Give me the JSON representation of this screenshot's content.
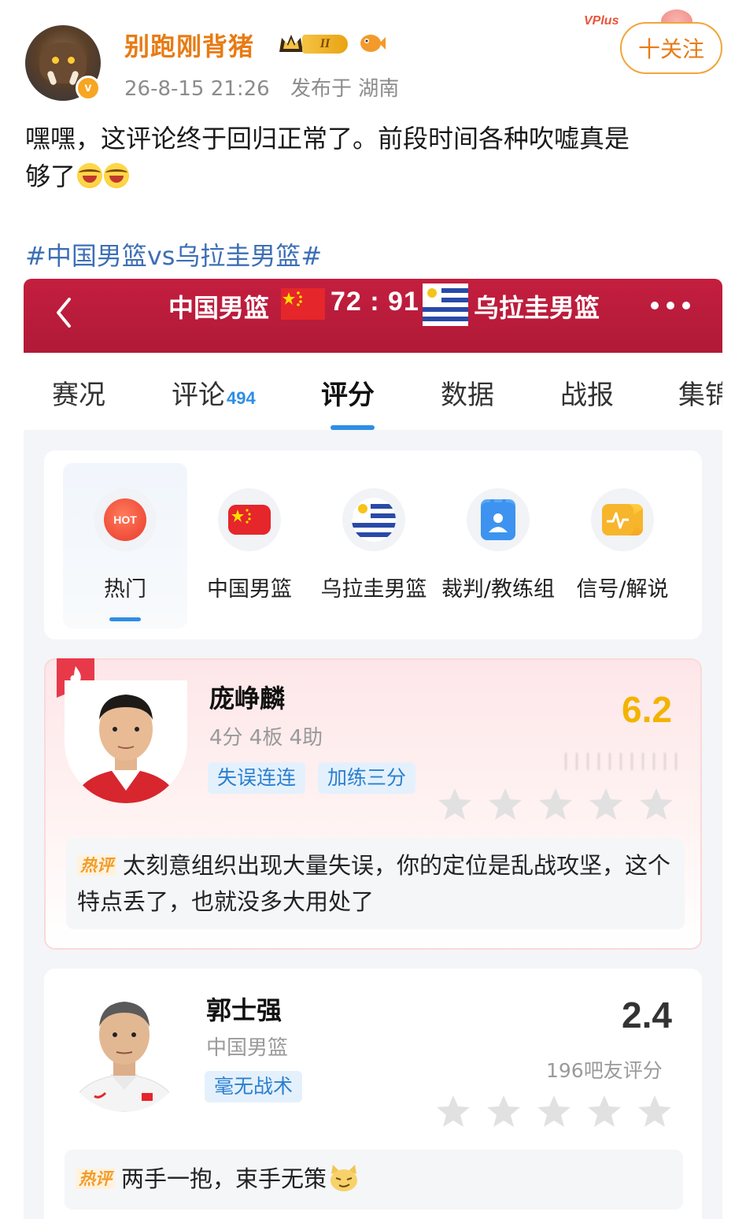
{
  "post": {
    "username": "别跑刚背猪",
    "vip_level": "II",
    "vplus_label": "VPlus",
    "timestamp": "26-8-15 21:26",
    "location": "发布于 湖南",
    "follow_label": "十关注",
    "text_line1": "嘿嘿，这评论终于回归正常了。前段时间各种吹嘘真是",
    "text_line2": "够了",
    "hashtag": "#中国男篮vs乌拉圭男篮#"
  },
  "game": {
    "home_team": "中国男篮",
    "score": "72 : 91",
    "away_team": "乌拉圭男篮",
    "colors": {
      "header": "#c41e3f",
      "accent": "#2d8ee6",
      "score_gold": "#f2b400"
    }
  },
  "tabs": [
    {
      "label": "赛况",
      "count": ""
    },
    {
      "label": "评论",
      "count": "494"
    },
    {
      "label": "评分",
      "count": ""
    },
    {
      "label": "数据",
      "count": ""
    },
    {
      "label": "战报",
      "count": ""
    },
    {
      "label": "集锦",
      "count": ""
    }
  ],
  "active_tab": "评分",
  "categories": [
    {
      "label": "热门",
      "icon": "hot-icon",
      "icon_text": "HOT"
    },
    {
      "label": "中国男篮",
      "icon": "china-flag-icon"
    },
    {
      "label": "乌拉圭男篮",
      "icon": "uruguay-flag-icon"
    },
    {
      "label": "裁判/教练组",
      "icon": "referee-icon"
    },
    {
      "label": "信号/解说",
      "icon": "broadcast-icon"
    }
  ],
  "players": [
    {
      "name": "庞峥麟",
      "stats": "4分 4板 4助",
      "tags": [
        "失误连连",
        "加练三分"
      ],
      "score": "6.2",
      "score_color": "#f2b400",
      "rating_stars": 0,
      "hot_comment_label": "热评",
      "hot_comment": "太刻意组织出现大量失误，你的定位是乱战攻坚，这个特点丢了，也就没多大用处了"
    },
    {
      "name": "郭士强",
      "stats": "中国男篮",
      "tags": [
        "毫无战术"
      ],
      "score": "2.4",
      "score_color": "#333333",
      "votes": "196吧友评分",
      "rating_stars": 0,
      "hot_comment_label": "热评",
      "hot_comment": "两手一抱，束手无策"
    }
  ]
}
